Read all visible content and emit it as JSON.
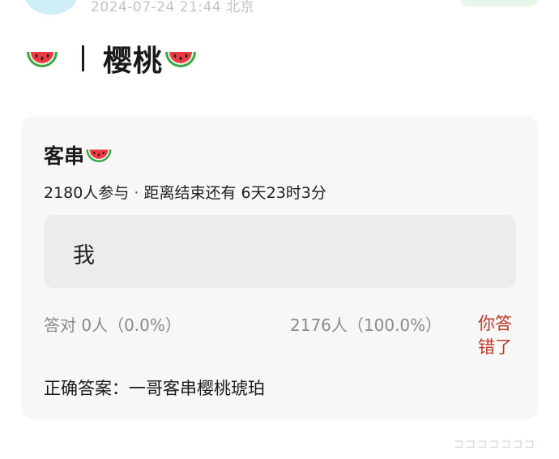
{
  "post": {
    "timestamp": "2024-07-24 21:44",
    "location": "北京",
    "title": "樱桃",
    "title_emoji_icon": "watermelon-icon"
  },
  "poll": {
    "title": "客串",
    "title_emoji_icon": "watermelon-icon",
    "participants": "2180人参与",
    "separator": "·",
    "time_left": "距离结束还有 6天23时3分",
    "option_text": "我",
    "option_label": "答对",
    "option_count": "0人（0.0%）",
    "other_stat": "2176人（100.0%）",
    "wrong_label": "你答错了",
    "correct_answer": "正确答案：一哥客串樱桃琥珀"
  },
  "watermark": "⊐⊐⊐⊐⊐⊐⊐",
  "colors": {
    "wrong": "#c0392b",
    "card_bg": "#f7f7f7",
    "option_bg": "#ececec",
    "avatar": "#cdeef7",
    "badge": "#e6f7ea"
  }
}
